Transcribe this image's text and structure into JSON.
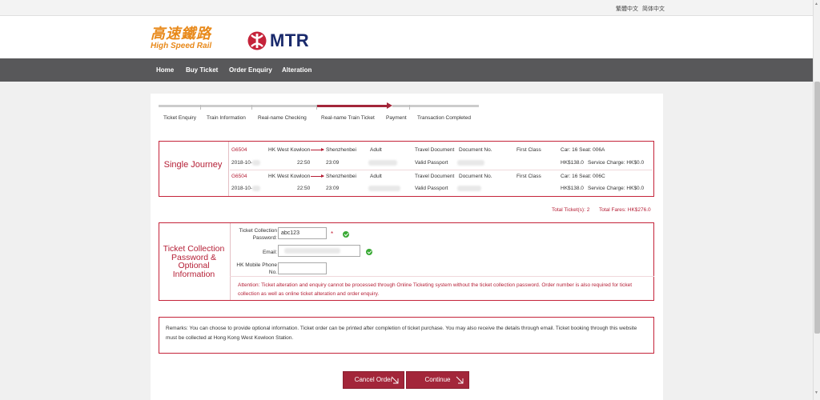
{
  "topbar": {
    "lang_tc": "繁體中文",
    "lang_sc": "简体中文"
  },
  "header": {
    "hsr_cn": "高速鐵路",
    "hsr_en": "High Speed Rail",
    "mtr_text": "MTR"
  },
  "nav": {
    "home": "Home",
    "buy": "Buy Ticket",
    "enquiry": "Order Enquiry",
    "alteration": "Alteration"
  },
  "steps": [
    {
      "label": "Ticket Enquiry"
    },
    {
      "label": "Train Information"
    },
    {
      "label": "Real-name Checking"
    },
    {
      "label": "Real-name Train Ticket"
    },
    {
      "label": "Payment"
    },
    {
      "label": "Transaction Completed"
    }
  ],
  "journey": {
    "title": "Single Journey",
    "tickets": [
      {
        "train": "G6504",
        "from": "HK West Kowloon",
        "to": "Shenzhenbei",
        "date": "2018-10-",
        "dep": "22:50",
        "arr": "23:09",
        "type": "Adult",
        "doc_label": "Travel Document",
        "doc_no_label": "Document No.",
        "doc_type": "Valid Passport",
        "class": "First Class",
        "car_seat": "Car: 16   Seat: 006A",
        "fare": "HK$138.0",
        "service": "Service Charge: HK$0.0"
      },
      {
        "train": "G6504",
        "from": "HK West Kowloon",
        "to": "Shenzhenbei",
        "date": "2018-10-",
        "dep": "22:50",
        "arr": "23:09",
        "type": "Adult",
        "doc_label": "Travel Document",
        "doc_no_label": "Document No.",
        "doc_type": "Valid Passport",
        "class": "First Class",
        "car_seat": "Car: 16   Seat: 006C",
        "fare": "HK$138.0",
        "service": "Service Charge: HK$0.0"
      }
    ]
  },
  "totals": {
    "tickets": "Total Ticket(s): 2",
    "fares": "Total Fares: HK$276.0"
  },
  "password_section": {
    "title": "Ticket Collection Password & Optional Information",
    "pw_label": "Ticket Collection Password:",
    "pw_value": "abc123",
    "required_mark": "*",
    "email_label": "Email:",
    "email_value": "",
    "phone_label": "HK Mobile Phone No.",
    "phone_value": "",
    "attention": "Attention: Ticket alteration and enquiry cannot be processed through Online Ticketing system without the ticket collection password. Order number is also required for ticket collection as well as online ticket alteration and order enquiry."
  },
  "remarks": "Remarks: You can choose to provide optional information. Ticket order can be printed after completion of ticket purchase. You may also receive the details through email. Ticket booking through this website must be collected at Hong Kong West Kowloon Station.",
  "buttons": {
    "cancel": "Cancel Order",
    "continue": "Continue"
  },
  "colors": {
    "accent": "#a3263a",
    "nav_bg": "#58585a",
    "hsr_orange": "#e8891a",
    "mtr_navy": "#1a2a6c",
    "success": "#3aaa35"
  }
}
